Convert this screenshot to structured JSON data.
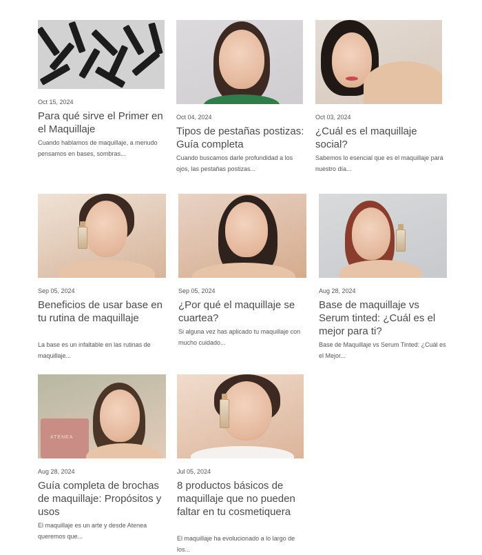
{
  "posts": [
    {
      "date": "Oct 15, 2024",
      "title": "Para qué sirve el Primer en el Maquillaje",
      "excerpt": "Cuando hablamos de maquillaje, a menudo pensamos en bases, sombras...",
      "image": "black-primer-tubes-photo"
    },
    {
      "date": "Oct 04, 2024",
      "title": "Tipos de pestañas postizas: Guía completa",
      "excerpt": "Cuando buscamos darle profundidad a los ojos, las pestañas postizas...",
      "image": "woman-portrait-photo"
    },
    {
      "date": "Oct 03, 2024",
      "title": "¿Cuál es el maquillaje social?",
      "excerpt": "Sabemos lo esencial que es el maquillaje para nuestro día...",
      "image": "woman-red-lips-photo"
    },
    {
      "date": "Sep 05, 2024",
      "title": "Beneficios de usar base en tu rutina de maquillaje",
      "excerpt": "La base es un infaltable en las rutinas de maquillaje...",
      "image": "woman-holding-foundation-photo"
    },
    {
      "date": "Sep 05, 2024",
      "title": "¿Por qué el maquillaje se cuartea?",
      "excerpt": "Si alguna vez has aplicado tu maquillaje con mucho cuidado...",
      "image": "woman-hand-on-chin-photo"
    },
    {
      "date": "Aug 28, 2024",
      "title": "Base de maquillaje vs Serum tinted: ¿Cuál es el mejor para ti?",
      "excerpt": "Base de Maquillaje vs Serum Tinted: ¿Cuál es el Mejor...",
      "image": "redhead-woman-foundation-photo"
    },
    {
      "date": "Aug 28, 2024",
      "title": "Guía completa de brochas de maquillaje: Propósitos y usos",
      "excerpt": "El maquillaje es un arte y desde Atenea queremos que...",
      "image": "woman-makeup-brush-palette-photo",
      "palette_text": "ATENEA"
    },
    {
      "date": "Jul 05, 2024",
      "title": "8 productos básicos de maquillaje que no pueden faltar en tu cosmetiquera",
      "excerpt": "El maquillaje ha evolucionado a lo largo de los...",
      "image": "woman-concealer-photo"
    }
  ],
  "colors": {
    "title": "#4a4a4a",
    "meta": "#555555",
    "background": "#ffffff"
  }
}
